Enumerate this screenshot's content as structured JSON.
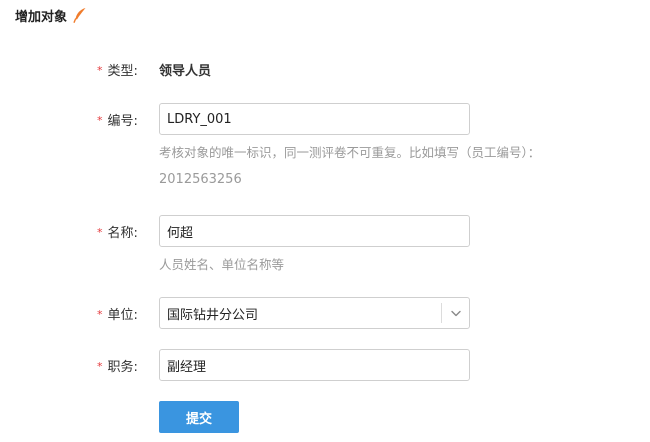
{
  "header": {
    "title": "增加对象",
    "icon": "feather-icon",
    "icon_color": "#f07c2c"
  },
  "form": {
    "required_mark": "*",
    "required_color": "#e4393c",
    "type": {
      "label": "类型:",
      "value": "领导人员"
    },
    "code": {
      "label": "编号:",
      "value": "LDRY_001",
      "hint_line1": "考核对象的唯一标识，同一测评卷不可重复。比如填写（员工编号）：",
      "hint_line2": "2012563256"
    },
    "name": {
      "label": "名称:",
      "value": "何超",
      "hint": "人员姓名、单位名称等"
    },
    "unit": {
      "label": "单位:",
      "value": "国际钻井分公司",
      "arrow_icon": "chevron-down-icon"
    },
    "position": {
      "label": "职务:",
      "value": "副经理"
    },
    "submit_label": "提交",
    "submit_color": "#3a95e0"
  }
}
